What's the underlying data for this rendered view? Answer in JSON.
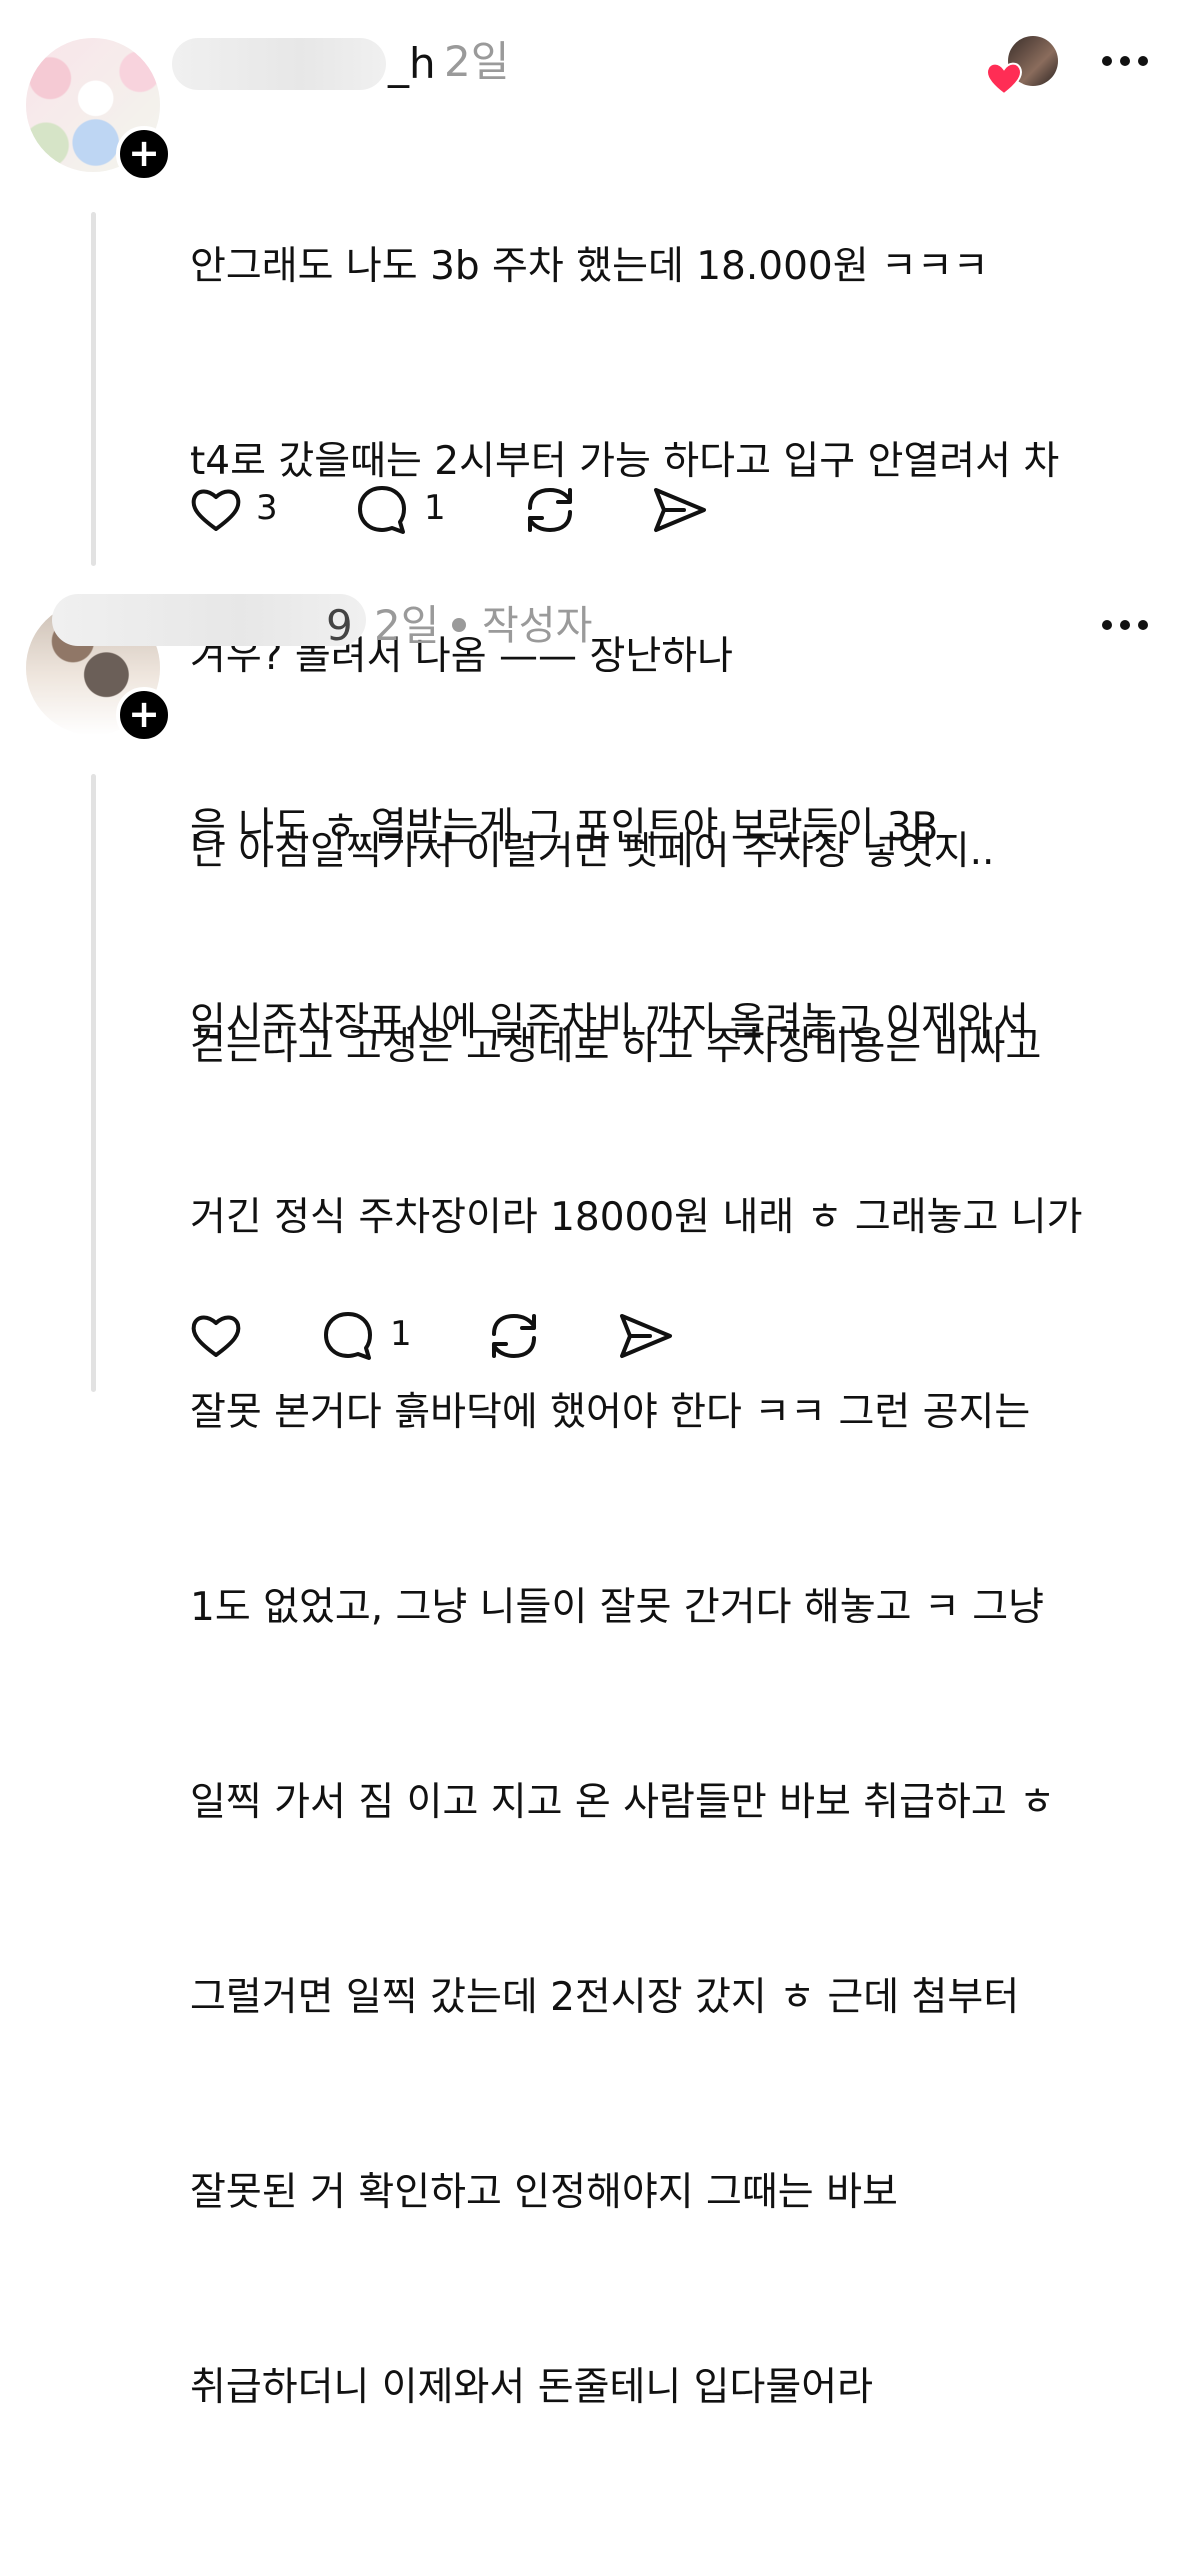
{
  "posts": [
    {
      "username_visible": "_h",
      "time": "2일",
      "lines": [
        "안그래도 나도 3b 주차 했는데 18.000원 ㅋㅋㅋ",
        "t4로 갔을때는 2시부터 가능 하다고 입구 안열려서 차",
        "겨우?  돌려서 나옴 —— 장난하나",
        "난 아침일찍가서 이럴거면 펫페어 주차장 넣엇지..",
        "걷는다고 고생은 고생데로 하고 주차장비용은 비싸고"
      ],
      "actions": {
        "like_count": "3",
        "reply_count": "1"
      },
      "icons": [
        "heart-icon",
        "comment-icon",
        "repost-icon",
        "share-icon",
        "more-icon",
        "plus-icon"
      ]
    },
    {
      "username_visible": "9",
      "time": "2일",
      "author_badge": "작성자",
      "lines": [
        "응 나도 ㅎ 열받는게 그 포인트야 보란듯이 3B",
        "임시주차장표시에 일주차비 까지 올려놓고 이제와서",
        "거긴 정식 주차장이라 18000원 내래 ㅎ 그래놓고 니가",
        "잘못 본거다 흙바닥에 했어야 한다 ㅋㅋ 그런 공지는",
        "1도 없었고, 그냥 니들이 잘못 간거다 해놓고 ㅋ 그냥",
        "일찍 가서 짐 이고 지고 온 사람들만 바보 취급하고 ㅎ",
        "그럴거면 일찍 갔는데 2전시장 갔지 ㅎ 근데 첨부터",
        "잘못된 거 확인하고 인정해야지 그때는 바보",
        "취급하더니 이제와서 돈줄테니 입다물어라"
      ],
      "actions": {
        "reply_count": "1"
      }
    }
  ],
  "colors": {
    "text": "#111111",
    "muted": "#9a9a9a",
    "thread_line": "#e2e2e2",
    "heart_badge": "#ff2d55"
  }
}
